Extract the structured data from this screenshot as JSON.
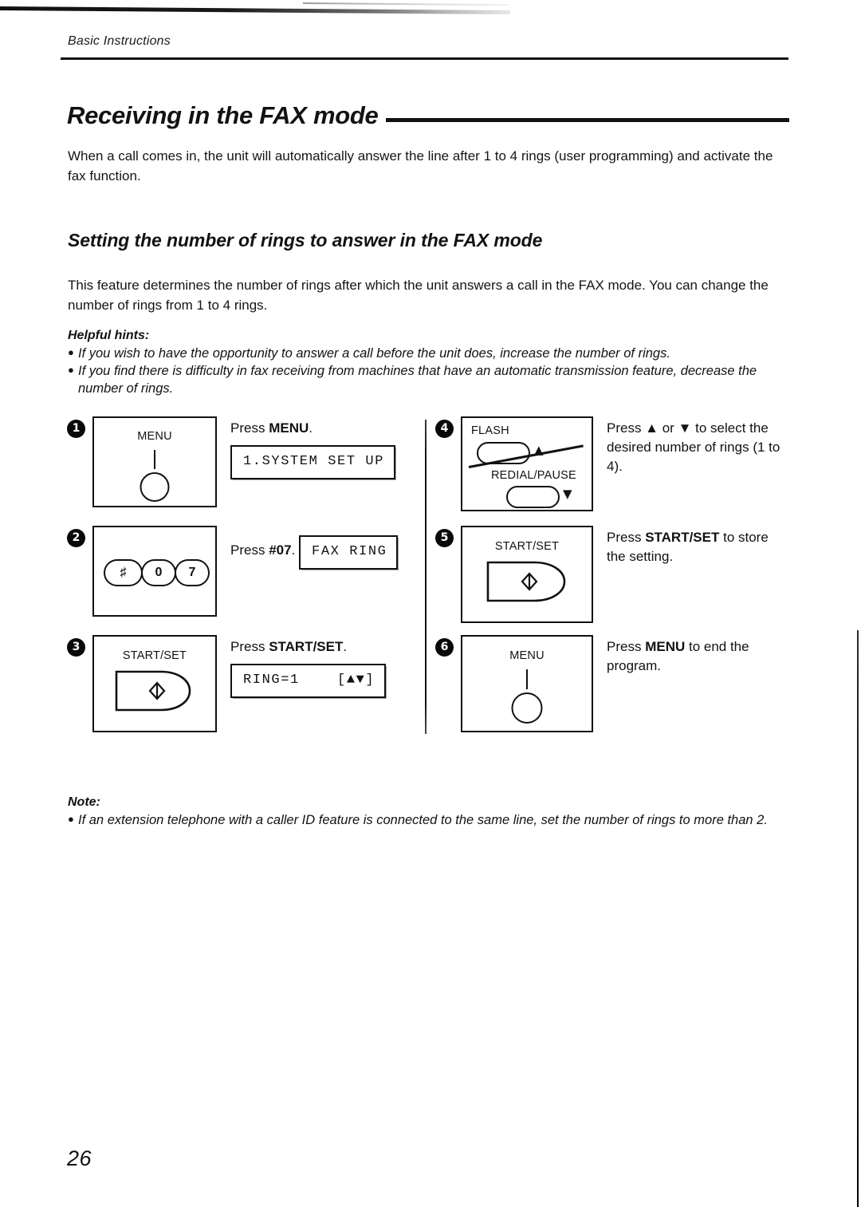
{
  "document": {
    "running_head": "Basic Instructions",
    "page_number": "26",
    "title": "Receiving in the FAX mode"
  },
  "intro": {
    "paragraph": "When a call comes in, the unit will automatically answer the line after 1 to 4 rings (user programming) and activate the fax function."
  },
  "section": {
    "heading": "Setting the number of rings to answer in the FAX mode",
    "paragraph": "This feature determines the number of rings after which the unit answers a call in the FAX mode. You can change the number of rings from 1 to 4 rings."
  },
  "hints": {
    "title": "Helpful hints:",
    "bullet_glyph": "●",
    "items": [
      "If you wish to have the opportunity to answer a call before the unit does, increase the number of rings.",
      "If you find there is difficulty in fax receiving from machines that have an automatic transmission feature, decrease the number of rings."
    ]
  },
  "note": {
    "title": "Note:",
    "bullet_glyph": "●",
    "items": [
      "If an extension telephone with a caller ID feature is connected to the same line, set the number of rings to more than 2."
    ]
  },
  "steps": [
    {
      "number": "1",
      "panel_type": "menu-button",
      "panel_label": "MENU",
      "instruction_prefix": "Press ",
      "instruction_key": "MENU",
      "instruction_suffix": ".",
      "lcd": "1.SYSTEM SET UP"
    },
    {
      "number": "2",
      "panel_type": "keypad",
      "keys": [
        "♯",
        "0",
        "7"
      ],
      "instruction_prefix": "Press ",
      "instruction_key": "#07",
      "instruction_suffix": ".",
      "lcd": "FAX RING"
    },
    {
      "number": "3",
      "panel_type": "start-set-button",
      "panel_label": "START/SET",
      "instruction_prefix": "Press ",
      "instruction_key": "START/SET",
      "instruction_suffix": ".",
      "lcd": "RING=1    [▲▼]"
    },
    {
      "number": "4",
      "panel_type": "flash-redial",
      "panel_label_top": "FLASH",
      "panel_label_bottom": "REDIAL/PAUSE",
      "arrow_up": "▲",
      "arrow_down": "▼",
      "instruction_full": "Press ▲ or ▼ to select the desired number of rings (1 to 4).",
      "lcd": ""
    },
    {
      "number": "5",
      "panel_type": "start-set-button",
      "panel_label": "START/SET",
      "instruction_prefix": "Press ",
      "instruction_key": "START/SET",
      "instruction_suffix": " to store the setting.",
      "lcd": ""
    },
    {
      "number": "6",
      "panel_type": "menu-button",
      "panel_label": "MENU",
      "instruction_prefix": "Press ",
      "instruction_key": "MENU",
      "instruction_suffix": " to end the program.",
      "lcd": ""
    }
  ],
  "colors": {
    "ink": "#111111",
    "paper": "#ffffff"
  }
}
